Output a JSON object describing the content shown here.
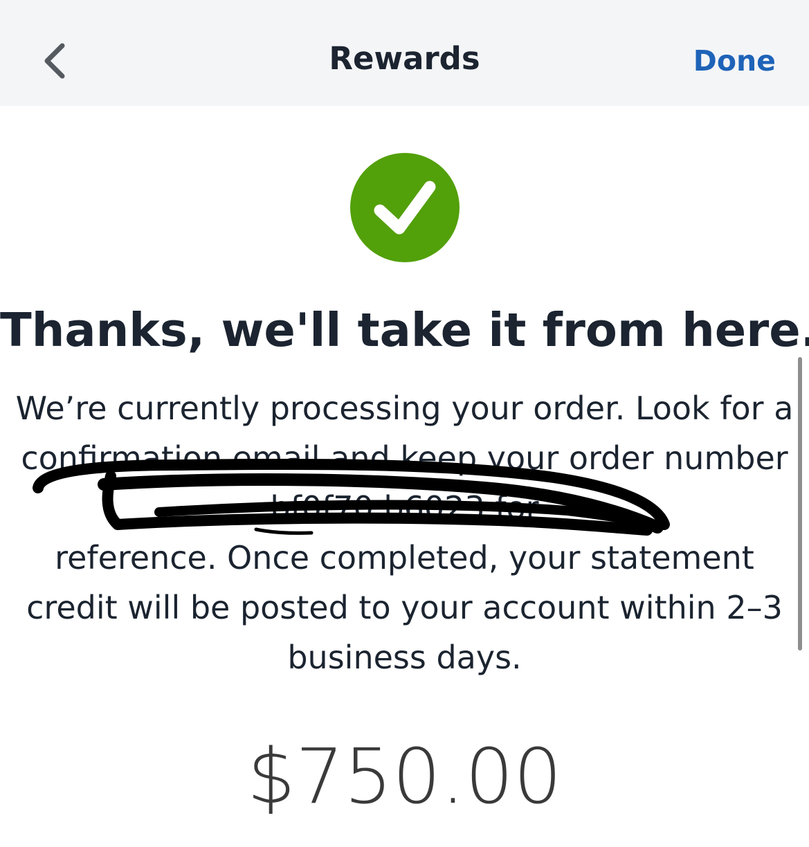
{
  "header": {
    "title": "Rewards",
    "done_label": "Done",
    "back_icon": "chevron-left-icon",
    "background": "#f4f5f7",
    "link_color": "#1e63b8"
  },
  "success": {
    "icon": "check-circle-icon",
    "color": "#52a00a",
    "headline": "Thanks, we'll take it from here.",
    "lines": [
      "We’re currently processing your order. Look for a",
      "confirmation email and keep your order number",
      "bf0f70                                         b6023 for",
      "reference. Once completed, your statement",
      "credit will be posted to your account within 2–3",
      "business days."
    ]
  },
  "amount": "$750.00"
}
